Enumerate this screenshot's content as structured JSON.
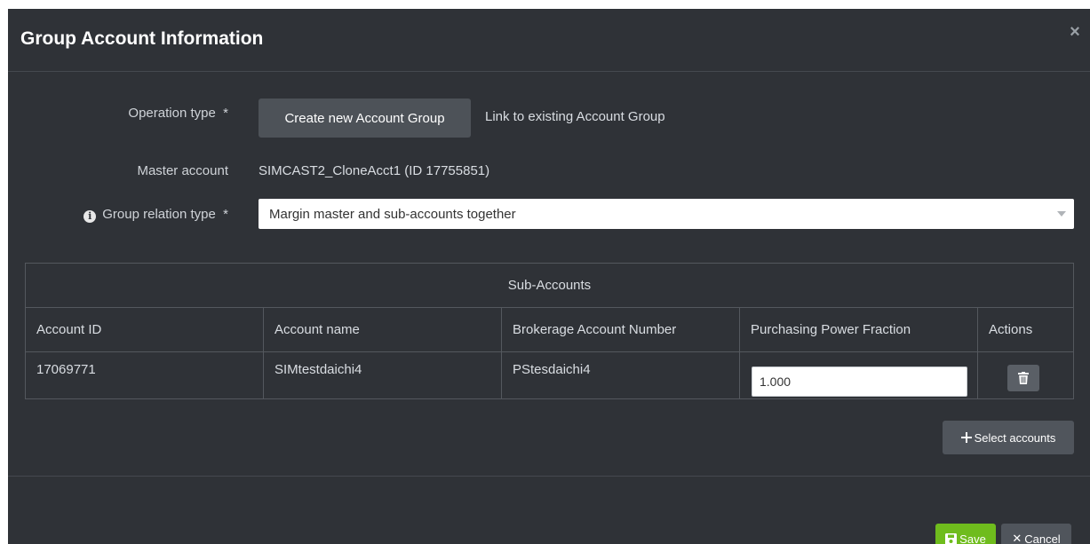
{
  "modal": {
    "title": "Group Account Information",
    "close_icon": "close-icon"
  },
  "form": {
    "operation_type_label": "Operation type  *",
    "operation_options": {
      "create_new": "Create new Account Group",
      "link_existing": "Link to existing Account Group"
    },
    "master_account_label": "Master account",
    "master_account_value": "SIMCAST2_CloneAcct1 (ID 17755851)",
    "group_relation_label": "Group relation type  *",
    "group_relation_info_icon": "info-icon",
    "group_relation_value": "Margin master and sub-accounts together"
  },
  "sub_accounts": {
    "caption": "Sub-Accounts",
    "columns": [
      "Account ID",
      "Account name",
      "Brokerage Account Number",
      "Purchasing Power Fraction",
      "Actions"
    ],
    "rows": [
      {
        "account_id": "17069771",
        "account_name": "SIMtestdaichi4",
        "brokerage_number": "PStesdaichi4",
        "pp_fraction": "1.000",
        "action_icon": "trash-icon"
      }
    ]
  },
  "actions": {
    "select_accounts": "Select accounts",
    "save": "Save",
    "cancel": "Cancel"
  },
  "colors": {
    "modal_bg": "#2f3237",
    "save_green": "#6fbc1d",
    "button_gray": "#4d5258"
  }
}
